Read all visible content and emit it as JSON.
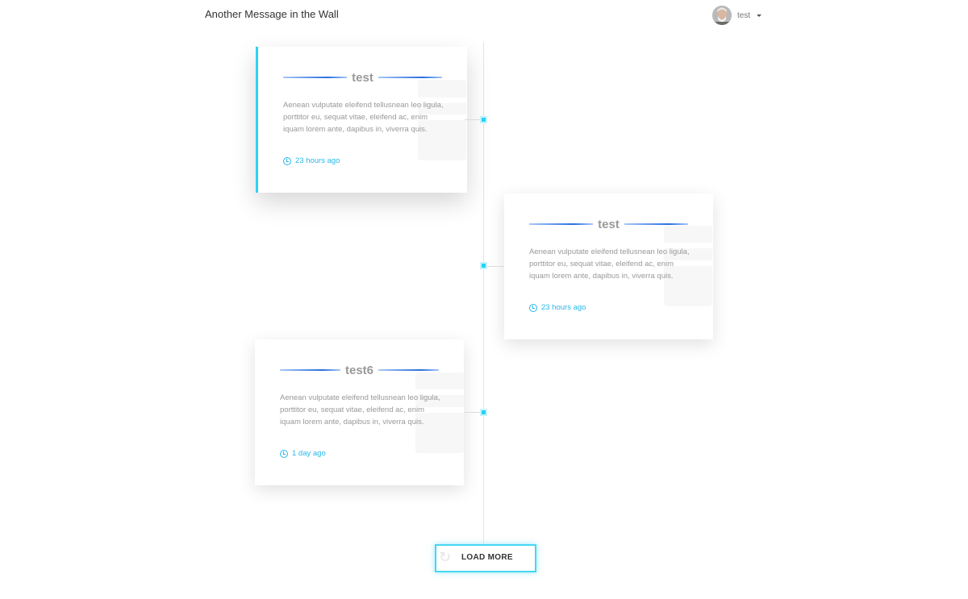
{
  "navbar": {
    "brand": "Another Message in the Wall",
    "user_name": "test"
  },
  "posts": [
    {
      "title": "test",
      "body": "Aenean vulputate eleifend tellusnean leo ligula, porttitor eu, sequat vitae, eleifend ac, enim iquam lorem ante, dapibus in, viverra quis.",
      "time": "23 hours ago"
    },
    {
      "title": "test",
      "body": "Aenean vulputate eleifend tellusnean leo ligula, porttitor eu, sequat vitae, eleifend ac, enim iquam lorem ante, dapibus in, viverra quis.",
      "time": "23 hours ago"
    },
    {
      "title": "test6",
      "body": "Aenean vulputate eleifend tellusnean leo ligula, porttitor eu, sequat vitae, eleifend ac, enim iquam lorem ante, dapibus in, viverra quis.",
      "time": "1 day ago"
    }
  ],
  "load_more_label": "LOAD MORE",
  "colors": {
    "accent": "#30d0f0",
    "link": "#27b6ea",
    "title_line": "#2a6fe0"
  }
}
